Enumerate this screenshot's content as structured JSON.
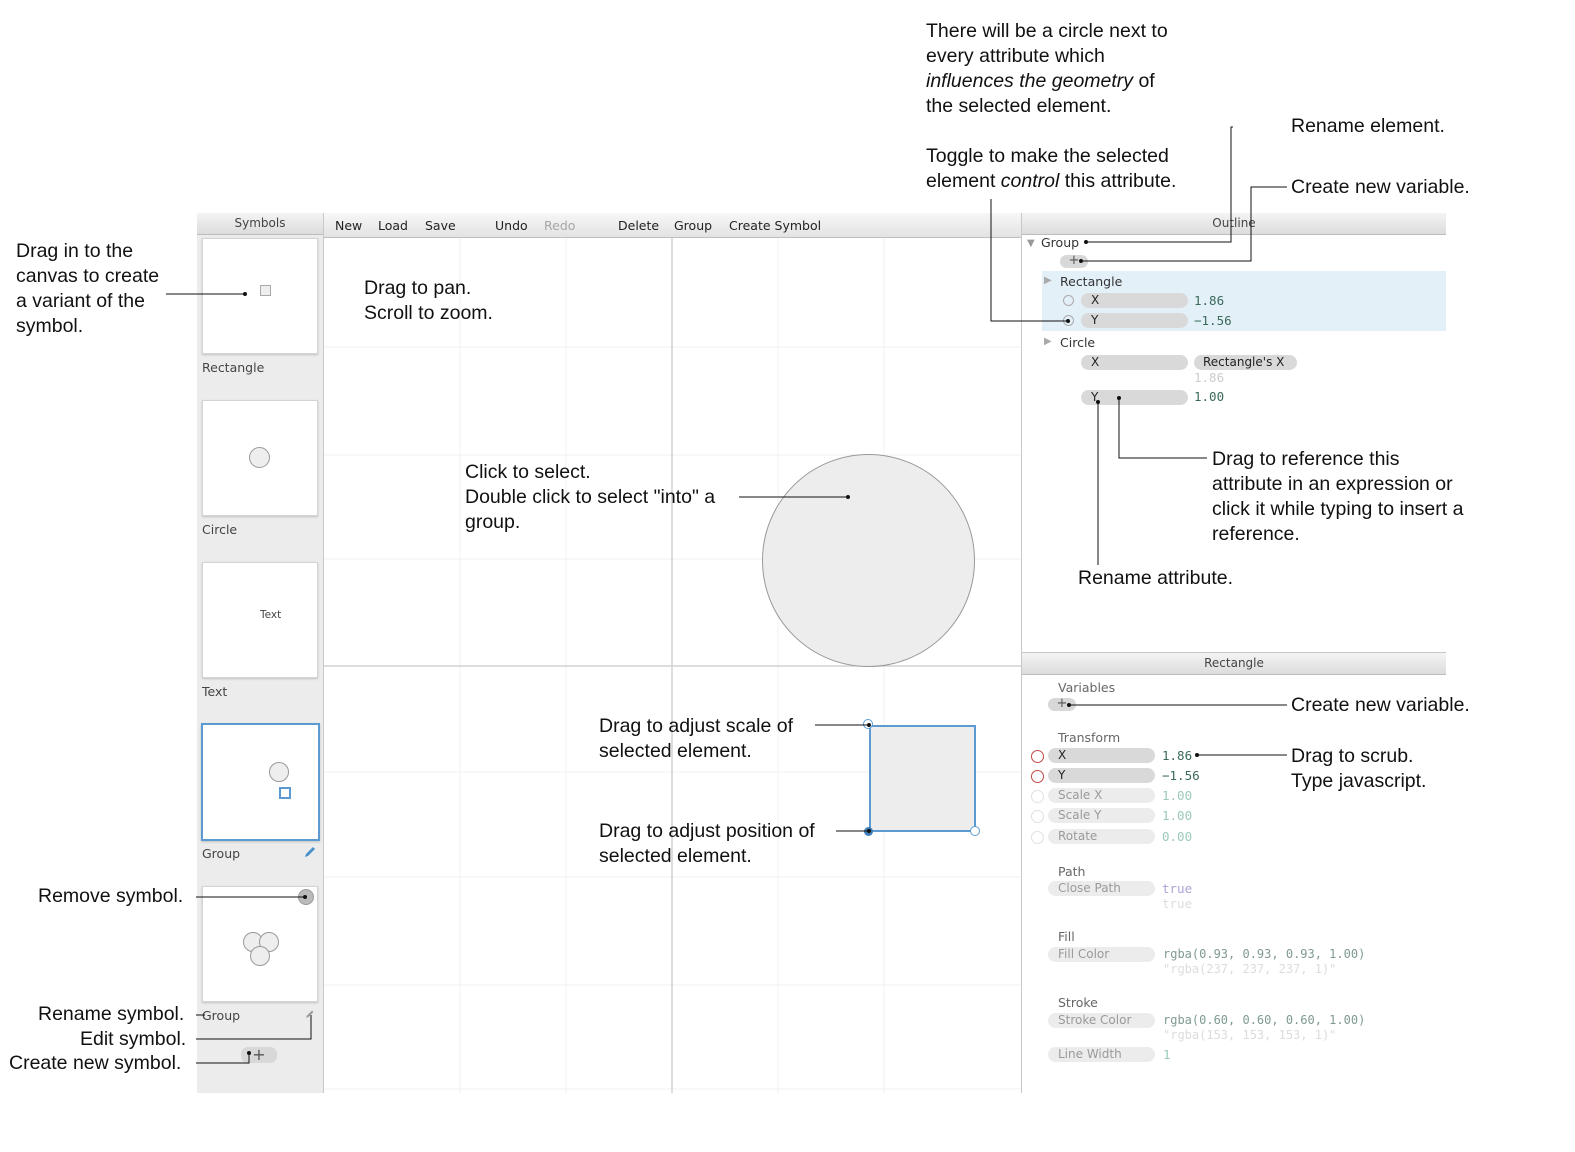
{
  "toolbar": {
    "new": "New",
    "load": "Load",
    "save": "Save",
    "undo": "Undo",
    "redo": "Redo",
    "delete": "Delete",
    "group": "Group",
    "create_symbol": "Create Symbol"
  },
  "symbols": {
    "header": "Symbols",
    "items": [
      {
        "label": "Rectangle"
      },
      {
        "label": "Circle"
      },
      {
        "label": "Text",
        "preview_text": "Text"
      },
      {
        "label": "Group",
        "selected": true
      },
      {
        "label": "Group"
      }
    ],
    "add_label": "+"
  },
  "outline": {
    "header": "Outline",
    "root": "Group",
    "add_label": "+",
    "elements": [
      {
        "name": "Rectangle",
        "attrs": [
          {
            "name": "X",
            "value": "1.86"
          },
          {
            "name": "Y",
            "value": "−1.56"
          }
        ]
      },
      {
        "name": "Circle",
        "attrs": [
          {
            "name": "X",
            "ref": "Rectangle's X",
            "value": "1.86"
          },
          {
            "name": "Y",
            "value": "1.00"
          }
        ]
      }
    ]
  },
  "inspector": {
    "header": "Rectangle",
    "variables": {
      "title": "Variables",
      "add_label": "+"
    },
    "transform": {
      "title": "Transform",
      "attrs": [
        {
          "name": "X",
          "value": "1.86"
        },
        {
          "name": "Y",
          "value": "−1.56"
        },
        {
          "name": "Scale X",
          "value": "1.00"
        },
        {
          "name": "Scale Y",
          "value": "1.00"
        },
        {
          "name": "Rotate",
          "value": "0.00"
        }
      ]
    },
    "path": {
      "title": "Path",
      "attrs": [
        {
          "name": "Close Path",
          "value": "true",
          "result": "true"
        }
      ]
    },
    "fill": {
      "title": "Fill",
      "attrs": [
        {
          "name": "Fill Color",
          "value": "rgba(0.93, 0.93, 0.93, 1.00)",
          "result": "\"rgba(237, 237, 237, 1)\""
        }
      ]
    },
    "stroke": {
      "title": "Stroke",
      "attrs": [
        {
          "name": "Stroke Color",
          "value": "rgba(0.60, 0.60, 0.60, 1.00)",
          "result": "\"rgba(153, 153, 153, 1)\""
        },
        {
          "name": "Line Width",
          "value": "1"
        }
      ]
    }
  },
  "annotations": {
    "circle_next_1": "There will be a circle next to",
    "circle_next_2": "every attribute which",
    "circle_next_3a": "influences the geometry",
    "circle_next_3b": " of",
    "circle_next_4": "the selected element.",
    "toggle_1": "Toggle to make the selected",
    "toggle_2a": "element ",
    "toggle_2b": "control",
    "toggle_2c": " this attribute.",
    "rename_element": "Rename element.",
    "create_variable_top": "Create new variable.",
    "drag_canvas_1": "Drag in to the",
    "drag_canvas_2": "canvas to create",
    "drag_canvas_3": "a variant of the",
    "drag_canvas_4": "symbol.",
    "pan_1": "Drag to pan.",
    "pan_2": "Scroll to zoom.",
    "select_1": "Click to select.",
    "select_2": "Double click to select \"into\" a",
    "select_3": "group.",
    "reference_1": "Drag to reference this",
    "reference_2": "attribute in an expression or",
    "reference_3": "click it while typing to insert a",
    "reference_4": "reference.",
    "rename_attribute": "Rename attribute.",
    "create_variable_bottom": "Create new variable.",
    "scrub_1": "Drag to scrub.",
    "scrub_2": "Type javascript.",
    "scale_1": "Drag to adjust scale of",
    "scale_2": "selected element.",
    "position_1": "Drag to adjust position of",
    "position_2": "selected element.",
    "remove_symbol": "Remove symbol.",
    "rename_symbol": "Rename symbol.",
    "edit_symbol": "Edit symbol.",
    "create_symbol": "Create new symbol."
  },
  "colors": {
    "selection": "#5b9bd1",
    "highlight_row": "#e4f0f8",
    "control_circle": "#c04848",
    "value_text": "#3a6a5a"
  }
}
